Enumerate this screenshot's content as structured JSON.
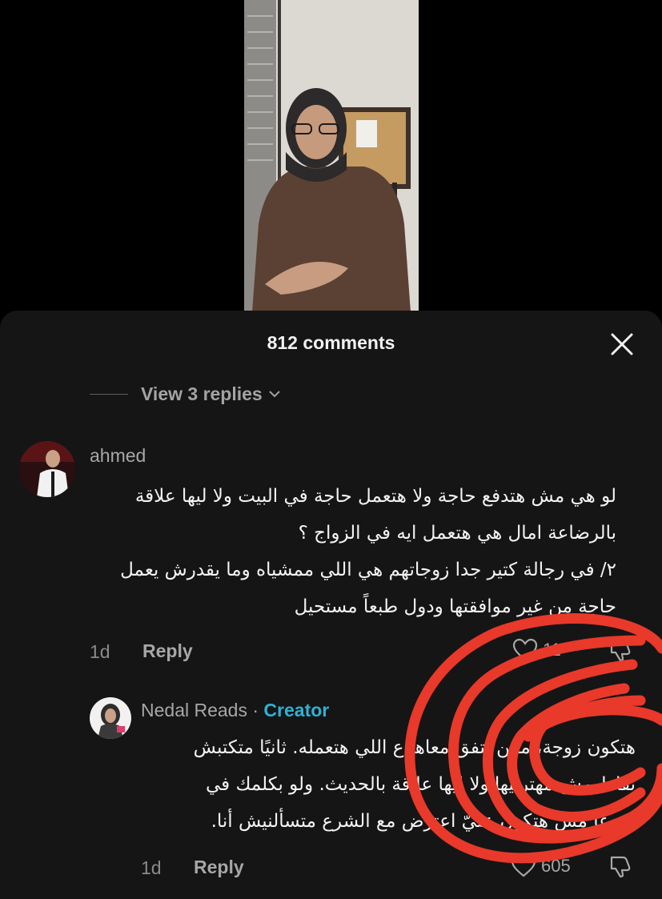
{
  "header": {
    "comments_count": "812 comments"
  },
  "thread": {
    "view_replies_label": "View 3 replies"
  },
  "comment": {
    "username": "ahmed",
    "lines": [
      "لو هي مش هتدفع حاجة ولا هتعمل حاجة في البيت ولا ليها علاقة",
      "بالرضاعة امال هي هتعمل ايه في الزواج ؟",
      "٢/ في رجالة كتير جدا زوجاتهم هي اللي ممشياه وما يقدرش يعمل",
      "حاجة من غير موافقتها ودول طبعاً مستحيل"
    ],
    "age": "1d",
    "reply_label": "Reply",
    "likes": "11"
  },
  "reply": {
    "username": "Nedal Reads",
    "separator": " · ",
    "creator_label": "Creator",
    "lines": [
      "هتكون زوجة، مكن تتفق معاها ع اللي هتعمله. ثانيًا متكتبش",
      "نقاط مش مهتربيها ولا ليها علاقة بالحديث. ولو بكلمك في",
      "شرعًا مش هتكون عليّ اعترض مع الشرع متسألنيش أنا."
    ],
    "age": "1d",
    "reply_label": "Reply",
    "likes": "605"
  },
  "colors": {
    "sheet_bg": "#151515",
    "creator_accent": "#2fb1d3",
    "annotation": "#e8392a"
  },
  "icons": [
    "close-icon",
    "chevron-down-icon",
    "heart-icon",
    "dislike-icon"
  ]
}
